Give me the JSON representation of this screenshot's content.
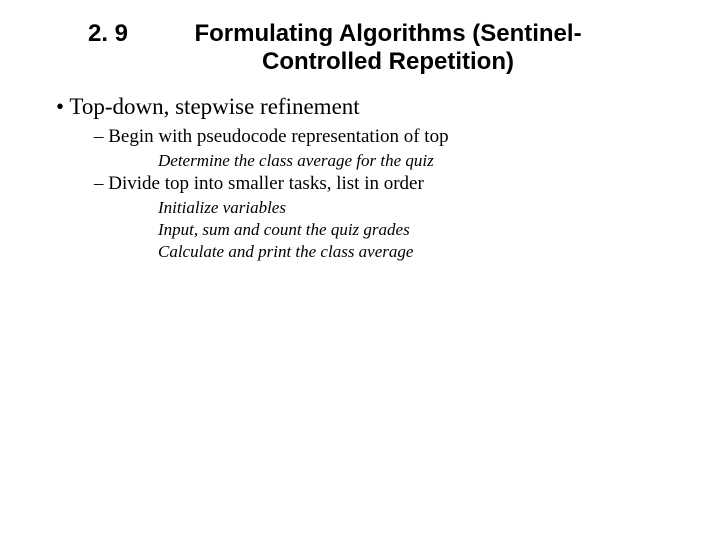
{
  "heading": {
    "number": "2. 9",
    "title": "Formulating Algorithms (Sentinel-Controlled Repetition)"
  },
  "content": {
    "bullet1": "Top-down, stepwise refinement",
    "sub1": {
      "label": "Begin with pseudocode representation of top",
      "italic": "Determine the class average for the quiz"
    },
    "sub2": {
      "label": "Divide top into smaller tasks, list in order",
      "italics": [
        "Initialize variables",
        "Input, sum and count the quiz grades",
        "Calculate and print the class average"
      ]
    }
  }
}
